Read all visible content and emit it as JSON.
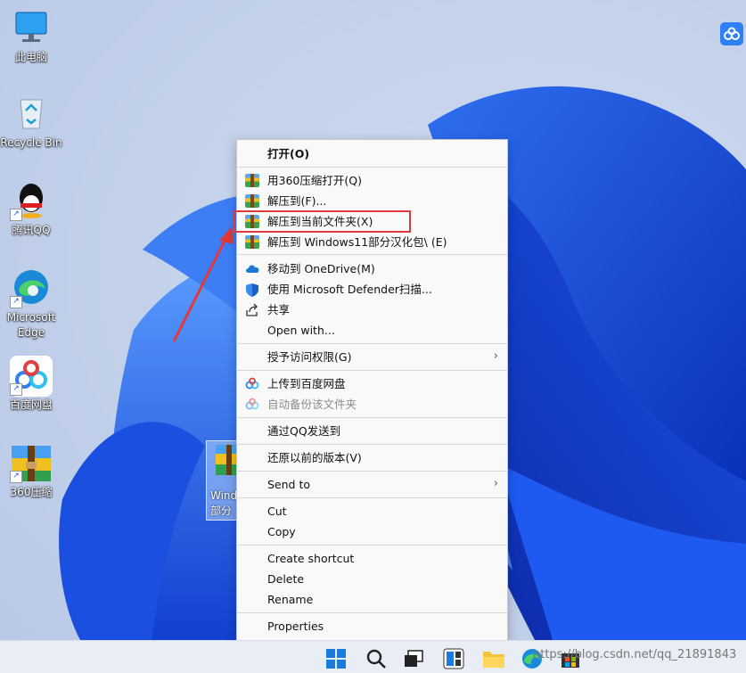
{
  "desktop": {
    "icons": [
      {
        "label": "此电脑",
        "icon": "computer-icon"
      },
      {
        "label": "Recycle Bin",
        "icon": "recycle-bin-icon"
      },
      {
        "label": "腾讯QQ",
        "icon": "qq-icon"
      },
      {
        "label": "Microsoft\nEdge",
        "icon": "edge-icon"
      },
      {
        "label": "百度网盘",
        "icon": "baidu-netdisk-icon"
      },
      {
        "label": "360压缩",
        "icon": "360-zip-icon"
      }
    ],
    "selected_file_label": "Wind\n部分"
  },
  "context_menu": {
    "open": "打开(O)",
    "zip_open": "用360压缩打开(Q)",
    "extract_to": "解压到(F)...",
    "extract_here": "解压到当前文件夹(X)",
    "extract_folder": "解压到 Windows11部分汉化包\\ (E)",
    "onedrive": "移动到 OneDrive(M)",
    "defender": "使用 Microsoft Defender扫描...",
    "share": "共享",
    "open_with": "Open with...",
    "grant_access": "授予访问权限(G)",
    "upload_baidu": "上传到百度网盘",
    "auto_backup": "自动备份该文件夹",
    "send_qq": "通过QQ发送到",
    "restore": "还原以前的版本(V)",
    "send_to": "Send to",
    "cut": "Cut",
    "copy": "Copy",
    "create_shortcut": "Create shortcut",
    "delete": "Delete",
    "rename": "Rename",
    "properties": "Properties"
  },
  "annotation_color": "#e03a3a",
  "taskbar": {
    "watermark": "https://blog.csdn.net/qq_21891843"
  }
}
